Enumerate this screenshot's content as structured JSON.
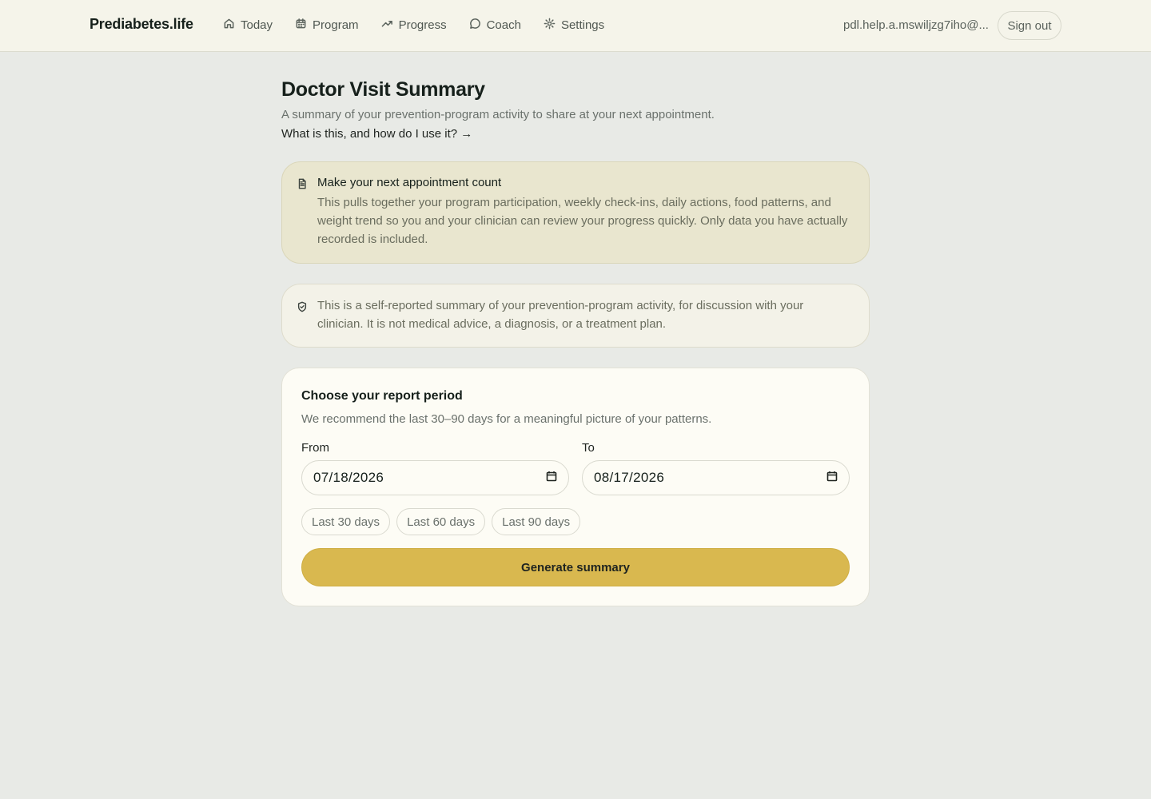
{
  "header": {
    "brand": "Prediabetes.life",
    "nav": [
      {
        "label": "Today",
        "icon": "home-icon"
      },
      {
        "label": "Program",
        "icon": "calendar-icon"
      },
      {
        "label": "Progress",
        "icon": "trending-up-icon"
      },
      {
        "label": "Coach",
        "icon": "chat-bubble-icon"
      },
      {
        "label": "Settings",
        "icon": "gear-icon"
      }
    ],
    "user_email": "pdl.help.a.mswiljzg7iho@...",
    "signout_label": "Sign out"
  },
  "page": {
    "title": "Doctor Visit Summary",
    "subtitle": "A summary of your prevention-program activity to share at your next appointment.",
    "help_link": "What is this, and how do I use it? →"
  },
  "info_card": {
    "icon": "document-icon",
    "title": "Make your next appointment count",
    "text": "This pulls together your program participation, weekly check-ins, daily actions, food patterns, and weight trend so you and your clinician can review your progress quickly. Only data you have actually recorded is included."
  },
  "disclaimer": {
    "icon": "shield-check-icon",
    "text": "This is a self-reported summary of your prevention-program activity, for discussion with your clinician. It is not medical advice, a diagnosis, or a treatment plan."
  },
  "report": {
    "title": "Choose your report period",
    "subtitle": "We recommend the last 30–90 days for a meaningful picture of your patterns.",
    "from_label": "From",
    "from_value": "07/18/2026",
    "to_label": "To",
    "to_value": "08/17/2026",
    "presets": [
      "Last 30 days",
      "Last 60 days",
      "Last 90 days"
    ],
    "generate_label": "Generate summary"
  },
  "colors": {
    "accent": "#d9b84f",
    "background": "#e8eae6",
    "topbar": "#f5f4ea",
    "info_card": "#e9e6cf",
    "card": "#fdfcf5"
  }
}
